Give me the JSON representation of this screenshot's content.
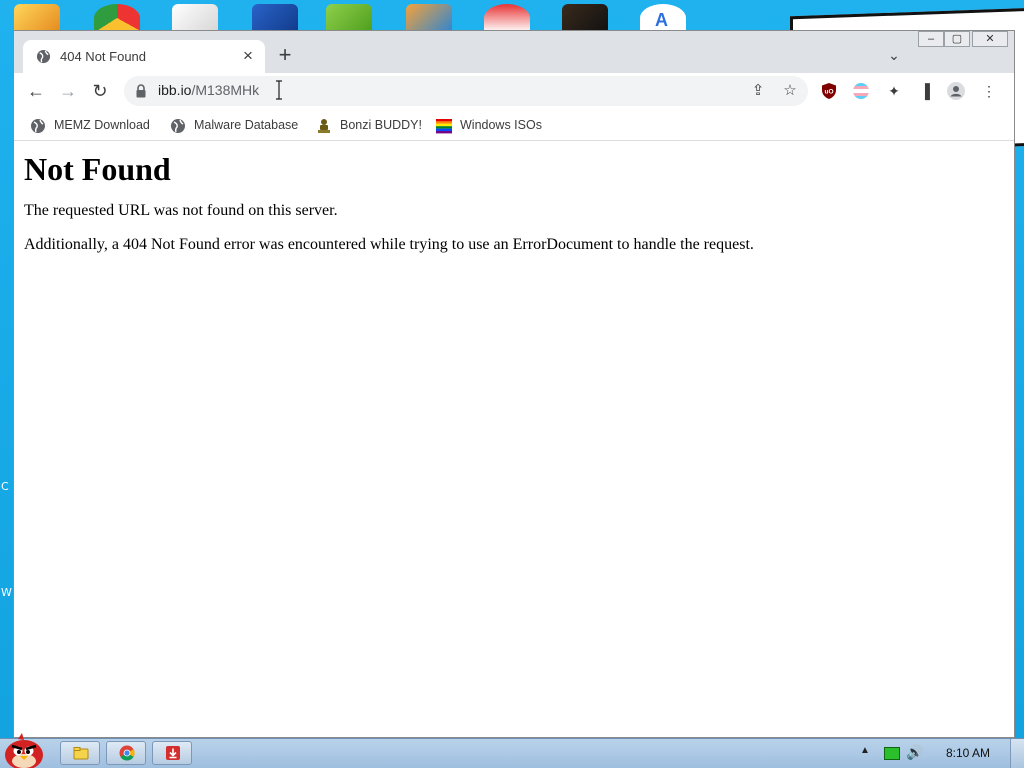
{
  "browser": {
    "tab": {
      "title": "404 Not Found",
      "close_glyph": "×"
    },
    "new_tab_glyph": "+",
    "tab_search_glyph": "⌄",
    "window_controls": {
      "minimize": "–",
      "maximize": "▢",
      "close": "✕"
    },
    "toolbar": {
      "back_glyph": "←",
      "forward_glyph": "→",
      "reload_glyph": "↻",
      "url_host": "ibb.io",
      "url_path": "/M138MHk",
      "share_glyph": "⇪",
      "star_glyph": "☆",
      "menu_glyph": "⋮",
      "puzzle_glyph": "✦",
      "sidepanel_glyph": "▐"
    },
    "bookmarks": [
      {
        "label": "MEMZ Download",
        "icon": "globe-icon"
      },
      {
        "label": "Malware Database",
        "icon": "globe-icon"
      },
      {
        "label": "Bonzi BUDDY!",
        "icon": "bonzi-icon"
      },
      {
        "label": "Windows ISOs",
        "icon": "rainbow-flag-icon"
      }
    ]
  },
  "page": {
    "heading": "Not Found",
    "paragraph_1": "The requested URL was not found on this server.",
    "paragraph_2": "Additionally, a 404 Not Found error was encountered while trying to use an ErrorDocument to handle the request."
  },
  "taskbar": {
    "clock": "8:10 AM",
    "tray_up_glyph": "▲",
    "volume_glyph": "🔊",
    "buttons": [
      {
        "icon": "explorer-folder-icon"
      },
      {
        "icon": "chrome-icon"
      },
      {
        "icon": "download-icon"
      }
    ]
  },
  "desktop": {
    "edge_letters": [
      "C",
      "W"
    ]
  },
  "colors": {
    "desktop": "#12a2e0",
    "titlebar": "#dee1e6",
    "omnibox": "#f1f3f4",
    "taskbar": "#a9c4df"
  }
}
